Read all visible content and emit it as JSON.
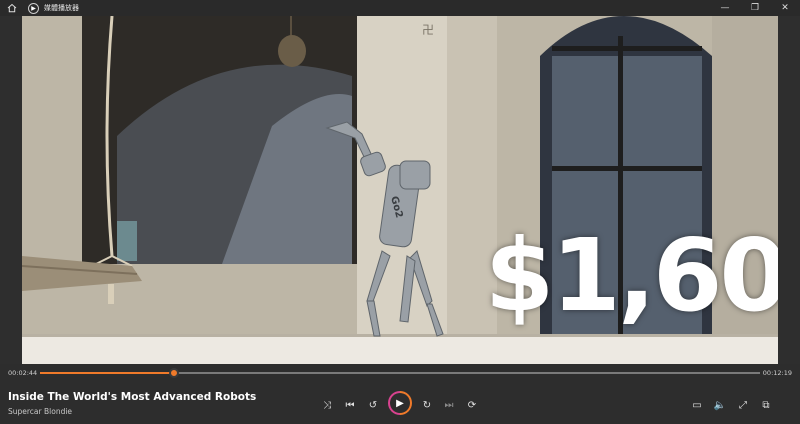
{
  "app": {
    "title": "媒體播放器"
  },
  "titlebar": {
    "home_icon": "home-icon",
    "minimize": "—",
    "maximize": "❐",
    "close": "✕"
  },
  "video": {
    "overlay_text": "$1,60"
  },
  "player": {
    "current_time": "00:02:44",
    "total_time": "00:12:19",
    "progress": 0.186,
    "title": "Inside The World's Most Advanced Robots",
    "channel": "Supercar Blondie"
  },
  "controls": {
    "shuffle": "⤨",
    "previous": "⏮",
    "rewind": "↺",
    "play": "▶",
    "forward": "↻",
    "next": "⏭",
    "repeat": "⟳",
    "captions": "▭",
    "volume": "🔈",
    "fullscreen": "⤢",
    "miniplayer": "⧉"
  }
}
